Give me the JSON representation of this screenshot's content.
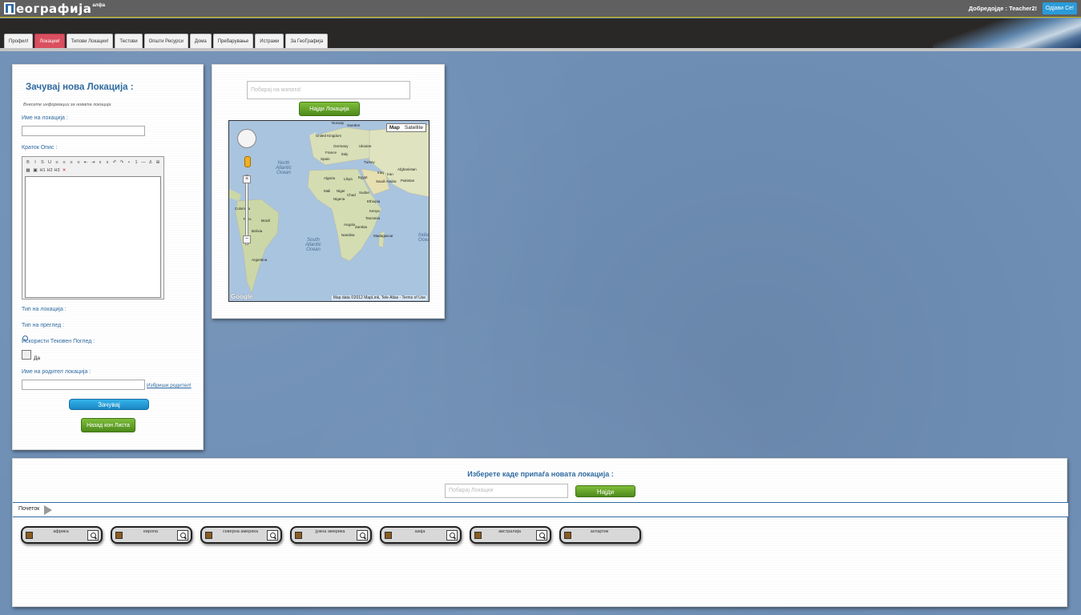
{
  "header": {
    "logo_text": "еографија",
    "logo_sup": "алфа",
    "welcome": "Добредојде : Teacher2!",
    "logout_label": "Одјави Се!"
  },
  "tabs": [
    {
      "label": "Профил!"
    },
    {
      "label": "Локации!",
      "active": true
    },
    {
      "label": "Типови Локации!"
    },
    {
      "label": "Тестови"
    },
    {
      "label": "Општи Ресурси"
    },
    {
      "label": "Дома"
    },
    {
      "label": "Пребарување"
    },
    {
      "label": "Истражи"
    },
    {
      "label": "За ГеоГрафија"
    }
  ],
  "form": {
    "title": "Зачувај нова Локација :",
    "hint": "Внесете информации за новата локација",
    "name_label": "Име на локација :",
    "desc_label": "Краток Опис :",
    "editor_toolbar": [
      "B",
      "I",
      "S",
      "U",
      "≡",
      "≡",
      "≡",
      "≡",
      "⇤",
      "⇥",
      "x",
      "x",
      "↶",
      "↷",
      "•",
      "1",
      "—",
      "⚓",
      "⊞",
      "▦",
      "▣",
      "H1",
      "H2",
      "H3",
      "✕"
    ],
    "type_label": "Тип на локација :",
    "view_label": "Тип на преглед :",
    "current_view_label": "Искористи Тековен Поглед :",
    "checkbox_label": "Да",
    "parent_label": "Име на родител локација :",
    "parent_link": "Избриши родител!",
    "save_label": "Зачувај",
    "back_label": "Назад кон Листа"
  },
  "map_panel": {
    "search_placeholder": "Побарај на мапата!",
    "find_label": "Најди Локација",
    "toggle_map": "Map",
    "toggle_satellite": "Satellite",
    "attribution": "Map data ©2012 MapLink, Tele Atlas - Terms of Use",
    "google": "Google",
    "places": [
      "Norway",
      "Sweden",
      "United Kingdom",
      "Germany",
      "Ukraine",
      "France",
      "Italy",
      "Spain",
      "Turkey",
      "Afghanistan",
      "Iraq",
      "Iran",
      "Algeria",
      "Libya",
      "Egypt",
      "Saudi Arabia",
      "Pakistan",
      "Mali",
      "Niger",
      "Chad",
      "Sudan",
      "Nigeria",
      "Ethiopia",
      "Kenya",
      "Tanzania",
      "Angola",
      "Zambia",
      "Namibia",
      "Madagascar",
      "Colombia",
      "Peru",
      "Brazil",
      "Bolivia",
      "Argentina"
    ],
    "oceans": [
      "North Atlantic Ocean",
      "South Atlantic Ocean",
      "Indian Ocean"
    ]
  },
  "selector": {
    "title": "Изберете каде припаѓа новата локација :",
    "search_placeholder": "Побарај Локации",
    "find_label": "Најди",
    "crumb": "Почеток",
    "continents": [
      "африка",
      "европа",
      "северна америка",
      "јужна америка",
      "азија",
      "австралија",
      "антартик"
    ]
  }
}
